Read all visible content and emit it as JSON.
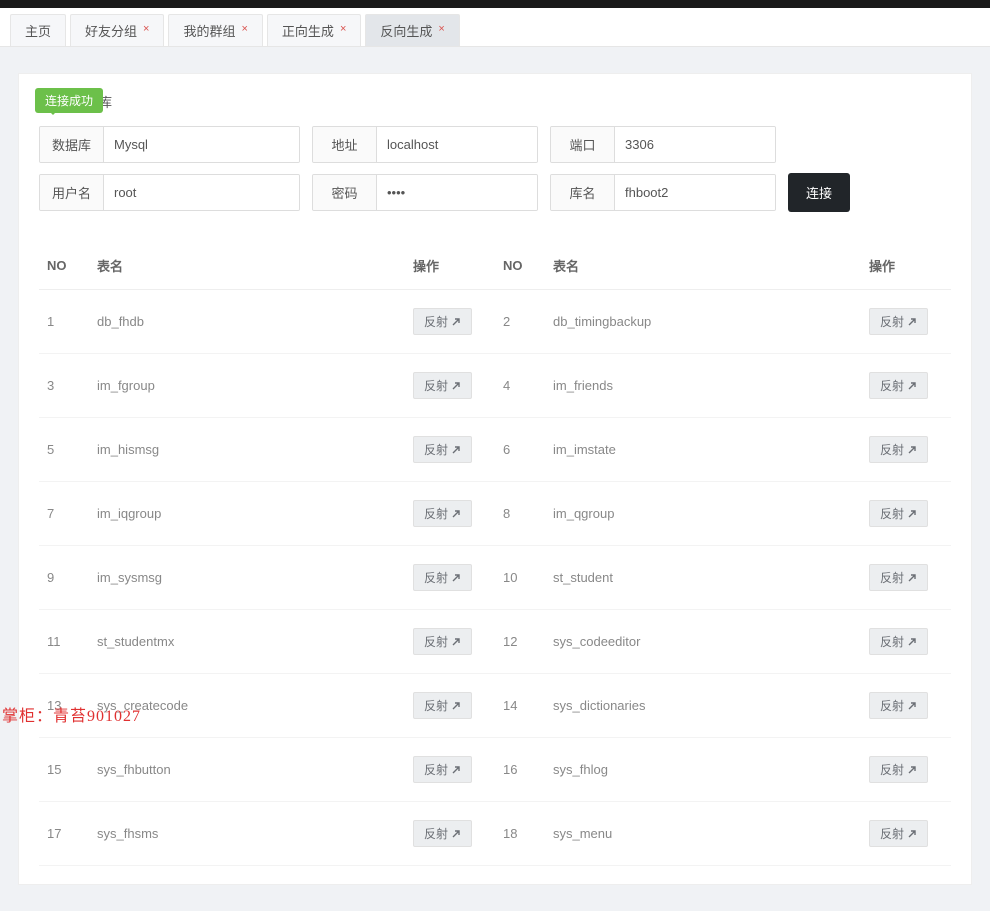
{
  "tabs": [
    {
      "label": "主页",
      "closable": false,
      "active": false
    },
    {
      "label": "好友分组",
      "closable": true,
      "active": false
    },
    {
      "label": "我的群组",
      "closable": true,
      "active": false
    },
    {
      "label": "正向生成",
      "closable": true,
      "active": false
    },
    {
      "label": "反向生成",
      "closable": true,
      "active": true
    }
  ],
  "panel": {
    "success_text": "连接成功",
    "title_suffix": "库",
    "form": {
      "db_label": "数据库",
      "db_value": "Mysql",
      "addr_label": "地址",
      "addr_value": "localhost",
      "port_label": "端口",
      "port_value": "3306",
      "user_label": "用户名",
      "user_value": "root",
      "pwd_label": "密码",
      "pwd_value": "••••",
      "dbname_label": "库名",
      "dbname_value": "fhboot2",
      "connect_btn": "连接"
    }
  },
  "table_headers": {
    "no": "NO",
    "name": "表名",
    "op": "操作"
  },
  "reflect_label": "反射",
  "tables_left": [
    {
      "no": "1",
      "name": "db_fhdb"
    },
    {
      "no": "3",
      "name": "im_fgroup"
    },
    {
      "no": "5",
      "name": "im_hismsg"
    },
    {
      "no": "7",
      "name": "im_iqgroup"
    },
    {
      "no": "9",
      "name": "im_sysmsg"
    },
    {
      "no": "11",
      "name": "st_studentmx"
    },
    {
      "no": "13",
      "name": "sys_createcode"
    },
    {
      "no": "15",
      "name": "sys_fhbutton"
    },
    {
      "no": "17",
      "name": "sys_fhsms"
    }
  ],
  "tables_right": [
    {
      "no": "2",
      "name": "db_timingbackup"
    },
    {
      "no": "4",
      "name": "im_friends"
    },
    {
      "no": "6",
      "name": "im_imstate"
    },
    {
      "no": "8",
      "name": "im_qgroup"
    },
    {
      "no": "10",
      "name": "st_student"
    },
    {
      "no": "12",
      "name": "sys_codeeditor"
    },
    {
      "no": "14",
      "name": "sys_dictionaries"
    },
    {
      "no": "16",
      "name": "sys_fhlog"
    },
    {
      "no": "18",
      "name": "sys_menu"
    }
  ],
  "watermark": "掌柜：青苔901027"
}
